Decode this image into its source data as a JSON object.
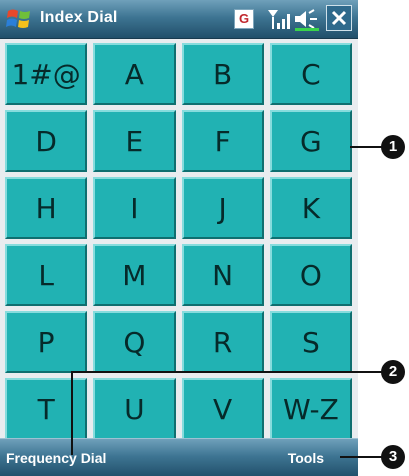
{
  "titlebar": {
    "title": "Index Dial",
    "g_icon_label": "G",
    "icons": [
      "windows-start-icon",
      "signal-icon",
      "volume-icon",
      "close-icon"
    ]
  },
  "keys": [
    "1#@",
    "A",
    "B",
    "C",
    "D",
    "E",
    "F",
    "G",
    "H",
    "I",
    "J",
    "K",
    "L",
    "M",
    "N",
    "O",
    "P",
    "Q",
    "R",
    "S",
    "T",
    "U",
    "V",
    "W-Z"
  ],
  "bottombar": {
    "left_softkey": "Frequency Dial",
    "right_softkey": "Tools"
  },
  "callouts": [
    "1",
    "2",
    "3"
  ],
  "colors": {
    "key": "#21b2b3",
    "bar": "#3e7593",
    "background": "#e9ecef"
  }
}
